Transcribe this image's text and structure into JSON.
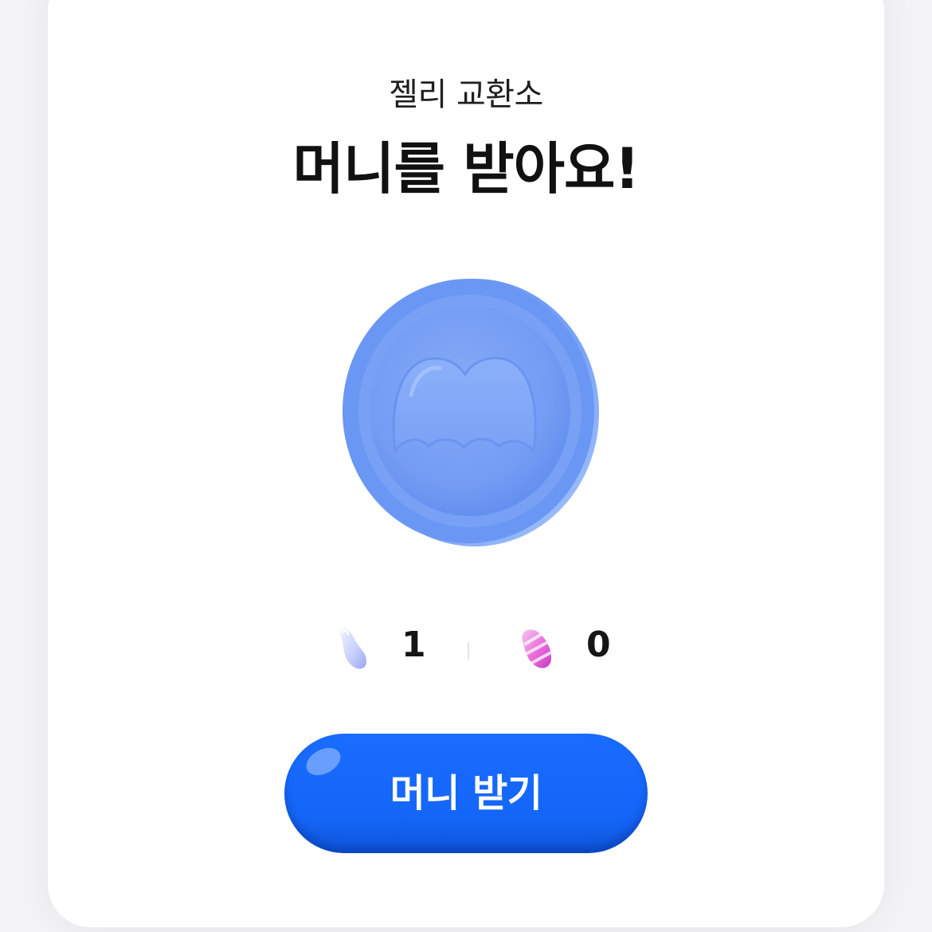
{
  "header": {
    "subtitle": "젤리 교환소",
    "title": "머니를 받아요!"
  },
  "coin": {
    "icon": "money-coin-icon",
    "color": "#6f9bf5"
  },
  "jellies": {
    "items": [
      {
        "icon": "blue-jelly-icon",
        "count": "1"
      },
      {
        "icon": "pink-jelly-icon",
        "count": "0"
      }
    ]
  },
  "action": {
    "button_label": "머니 받기",
    "button_color": "#1a6cff"
  }
}
